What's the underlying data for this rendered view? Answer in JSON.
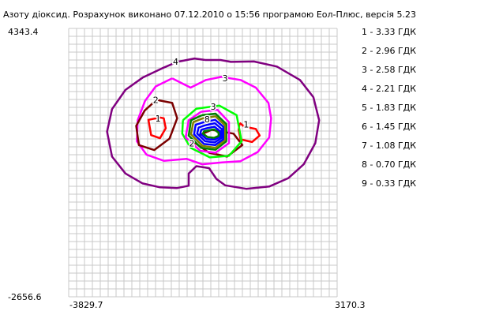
{
  "title": "Азоту діоксид. Розрахунок виконано 07.12.2010 о 15:56 програмою Еол-Плюс, версія 5.23",
  "axis": {
    "y_max_label": "4343.4",
    "y_min_label": "-2656.6",
    "x_min_label": "-3829.7",
    "x_max_label": "3170.3"
  },
  "legend": [
    "1 - 3.33 ГДК",
    "2 - 2.96 ГДК",
    "3 - 2.58 ГДК",
    "4 - 2.21 ГДК",
    "5 - 1.83 ГДК",
    "6 - 1.45 ГДК",
    "7 - 1.08 ГДК",
    "8 - 0.70 ГДК",
    "9 - 0.33 ГДК"
  ],
  "colors": {
    "grid": "#c8c8c8",
    "level_1": "#ff0000",
    "level_2": "#7b0000",
    "level_3": "#ff00ff",
    "level_4": "#800080",
    "level_5": "#0000ff",
    "level_6": "#008000",
    "level_7": "#00ff00",
    "level_8": "#808000",
    "level_9": "#00ffff"
  },
  "chart_data": {
    "type": "contour",
    "title": "Азоту діоксид. Розрахунок виконано 07.12.2010 о 15:56 програмою Еол-Плюс, версія 5.23",
    "xlim": [
      -3829.7,
      3170.3
    ],
    "ylim": [
      -2656.6,
      4343.4
    ],
    "grid": true,
    "grid_cells": [
      34,
      34
    ],
    "legend_position": "right",
    "levels": [
      {
        "label": "1",
        "value": 3.33,
        "unit": "ГДК"
      },
      {
        "label": "2",
        "value": 2.96,
        "unit": "ГДК"
      },
      {
        "label": "3",
        "value": 2.58,
        "unit": "ГДК"
      },
      {
        "label": "4",
        "value": 2.21,
        "unit": "ГДК"
      },
      {
        "label": "5",
        "value": 1.83,
        "unit": "ГДК"
      },
      {
        "label": "6",
        "value": 1.45,
        "unit": "ГДК"
      },
      {
        "label": "7",
        "value": 1.08,
        "unit": "ГДК"
      },
      {
        "label": "8",
        "value": 0.7,
        "unit": "ГДК"
      },
      {
        "label": "9",
        "value": 0.33,
        "unit": "ГДК"
      }
    ],
    "contours": [
      {
        "level": "4",
        "color": "#800080",
        "points": [
          [
            -270,
            3520
          ],
          [
            -550,
            3560
          ],
          [
            -1000,
            3470
          ],
          [
            -1400,
            3300
          ],
          [
            -1900,
            3060
          ],
          [
            -2350,
            2740
          ],
          [
            -2700,
            2240
          ],
          [
            -2830,
            1650
          ],
          [
            -2700,
            1000
          ],
          [
            -2350,
            560
          ],
          [
            -1900,
            300
          ],
          [
            -1450,
            200
          ],
          [
            -1000,
            180
          ],
          [
            -700,
            240
          ],
          [
            -700,
            560
          ],
          [
            -500,
            750
          ],
          [
            -170,
            700
          ],
          [
            20,
            420
          ],
          [
            250,
            250
          ],
          [
            800,
            160
          ],
          [
            1400,
            220
          ],
          [
            1900,
            440
          ],
          [
            2300,
            800
          ],
          [
            2600,
            1350
          ],
          [
            2700,
            1950
          ],
          [
            2550,
            2550
          ],
          [
            2200,
            3000
          ],
          [
            1600,
            3350
          ],
          [
            1000,
            3480
          ],
          [
            400,
            3470
          ],
          [
            130,
            3520
          ],
          [
            -130,
            3520
          ],
          [
            -270,
            3520
          ]
        ]
      },
      {
        "level": "3",
        "color": "#ff00ff",
        "points": [
          [
            -1130,
            3040
          ],
          [
            -1560,
            2830
          ],
          [
            -1840,
            2450
          ],
          [
            -2030,
            1950
          ],
          [
            -2050,
            1400
          ],
          [
            -1800,
            1050
          ],
          [
            -1350,
            890
          ],
          [
            -750,
            940
          ],
          [
            -350,
            800
          ],
          [
            170,
            850
          ],
          [
            650,
            880
          ],
          [
            1100,
            1120
          ],
          [
            1400,
            1500
          ],
          [
            1450,
            2000
          ],
          [
            1380,
            2400
          ],
          [
            1050,
            2800
          ],
          [
            650,
            3000
          ],
          [
            150,
            3080
          ],
          [
            -250,
            3000
          ],
          [
            -650,
            2800
          ],
          [
            -950,
            2950
          ],
          [
            -1130,
            3040
          ]
        ]
      },
      {
        "level": "2",
        "color": "#7b0000",
        "points": [
          [
            -1540,
            2480
          ],
          [
            -1850,
            2200
          ],
          [
            -2070,
            1800
          ],
          [
            -2000,
            1300
          ],
          [
            -1600,
            1170
          ],
          [
            -1200,
            1470
          ],
          [
            -1000,
            2000
          ],
          [
            -1130,
            2400
          ],
          [
            -1540,
            2480
          ]
        ]
      },
      {
        "level": "2",
        "color": "#7b0000",
        "points": [
          [
            -570,
            1380
          ],
          [
            -170,
            1100
          ],
          [
            300,
            1000
          ],
          [
            700,
            1300
          ],
          [
            470,
            1600
          ],
          [
            -100,
            1700
          ],
          [
            -420,
            1560
          ]
        ]
      },
      {
        "level": "1",
        "color": "#ff0000",
        "points": [
          [
            -1450,
            2020
          ],
          [
            -1750,
            1960
          ],
          [
            -1680,
            1560
          ],
          [
            -1450,
            1480
          ],
          [
            -1300,
            1740
          ],
          [
            -1350,
            2000
          ],
          [
            -1450,
            2020
          ]
        ]
      },
      {
        "level": "1",
        "color": "#ff0000",
        "points": [
          [
            630,
            1880
          ],
          [
            750,
            1780
          ],
          [
            1050,
            1720
          ],
          [
            1150,
            1550
          ],
          [
            950,
            1380
          ],
          [
            650,
            1450
          ],
          [
            600,
            1700
          ],
          [
            630,
            1880
          ]
        ]
      },
      {
        "level": "7",
        "color": "#00ff00",
        "points": [
          [
            -850,
            1950
          ],
          [
            -500,
            2250
          ],
          [
            100,
            2330
          ],
          [
            550,
            2080
          ],
          [
            680,
            1400
          ],
          [
            350,
            1020
          ],
          [
            -150,
            980
          ],
          [
            -650,
            1230
          ],
          [
            -870,
            1600
          ],
          [
            -850,
            1950
          ]
        ]
      },
      {
        "level": "3",
        "color": "#ff00ff",
        "points": [
          [
            -380,
            2170
          ],
          [
            50,
            2220
          ],
          [
            350,
            1900
          ],
          [
            350,
            1350
          ],
          [
            0,
            1100
          ],
          [
            -400,
            1150
          ],
          [
            -780,
            1500
          ],
          [
            -700,
            1950
          ],
          [
            -380,
            2170
          ]
        ]
      },
      {
        "level": "6",
        "color": "#008000",
        "points": [
          [
            -350,
            2080
          ],
          [
            0,
            2120
          ],
          [
            280,
            1850
          ],
          [
            280,
            1400
          ],
          [
            0,
            1180
          ],
          [
            -380,
            1230
          ],
          [
            -700,
            1550
          ],
          [
            -640,
            1950
          ],
          [
            -350,
            2080
          ]
        ]
      },
      {
        "level": "8",
        "color": "#808000",
        "points": [
          [
            -330,
            2000
          ],
          [
            0,
            2050
          ],
          [
            240,
            1820
          ],
          [
            240,
            1430
          ],
          [
            0,
            1230
          ],
          [
            -340,
            1280
          ],
          [
            -640,
            1580
          ],
          [
            -580,
            1900
          ],
          [
            -330,
            2000
          ]
        ]
      },
      {
        "level": "5",
        "color": "#0000ff",
        "points": [
          [
            -300,
            1900
          ],
          [
            -10,
            1960
          ],
          [
            200,
            1780
          ],
          [
            200,
            1450
          ],
          [
            -10,
            1300
          ],
          [
            -300,
            1330
          ],
          [
            -560,
            1580
          ],
          [
            -520,
            1830
          ],
          [
            -300,
            1900
          ]
        ]
      },
      {
        "level": "5",
        "color": "#0000ff",
        "points": [
          [
            -260,
            1820
          ],
          [
            -20,
            1870
          ],
          [
            160,
            1720
          ],
          [
            160,
            1490
          ],
          [
            -20,
            1370
          ],
          [
            -270,
            1400
          ],
          [
            -480,
            1600
          ],
          [
            -440,
            1760
          ],
          [
            -260,
            1820
          ]
        ]
      },
      {
        "level": "5",
        "color": "#0000ff",
        "points": [
          [
            -230,
            1740
          ],
          [
            -30,
            1780
          ],
          [
            120,
            1660
          ],
          [
            120,
            1520
          ],
          [
            -30,
            1440
          ],
          [
            -240,
            1460
          ],
          [
            -400,
            1600
          ],
          [
            -370,
            1700
          ],
          [
            -230,
            1740
          ]
        ]
      },
      {
        "level": "6",
        "color": "#008000",
        "points": [
          [
            -200,
            1680
          ],
          [
            -40,
            1710
          ],
          [
            80,
            1620
          ],
          [
            80,
            1540
          ],
          [
            -40,
            1490
          ],
          [
            -210,
            1510
          ],
          [
            -330,
            1600
          ],
          [
            -300,
            1660
          ],
          [
            -200,
            1680
          ]
        ]
      }
    ],
    "contour_labels": [
      {
        "text": "4",
        "x": -1040,
        "y": 3480
      },
      {
        "text": "3",
        "x": 250,
        "y": 3050
      },
      {
        "text": "3",
        "x": -60,
        "y": 2310
      },
      {
        "text": "2",
        "x": -1560,
        "y": 2480
      },
      {
        "text": "1",
        "x": -1500,
        "y": 2000
      },
      {
        "text": "1",
        "x": 800,
        "y": 1840
      },
      {
        "text": "2",
        "x": -620,
        "y": 1350
      },
      {
        "text": "8",
        "x": -220,
        "y": 1980
      }
    ]
  }
}
